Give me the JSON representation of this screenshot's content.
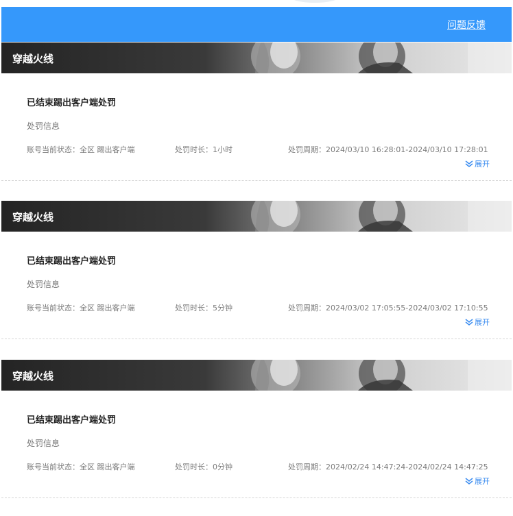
{
  "header": {
    "feedback_label": "问题反馈",
    "bg_color": "#3598fb"
  },
  "records": [
    {
      "game": "穿越火线",
      "status": "已结束踢出客户端处罚",
      "section_label": "处罚信息",
      "account_state": "账号当前状态：全区 踢出客户端",
      "duration": "处罚时长：1小时",
      "period": "处罚周期：2024/03/10 16:28:01-2024/03/10 17:28:01",
      "expand_label": "展开"
    },
    {
      "game": "穿越火线",
      "status": "已结束踢出客户端处罚",
      "section_label": "处罚信息",
      "account_state": "账号当前状态：全区 踢出客户端",
      "duration": "处罚时长：5分钟",
      "period": "处罚周期：2024/03/02 17:05:55-2024/03/02 17:10:55",
      "expand_label": "展开"
    },
    {
      "game": "穿越火线",
      "status": "已结束踢出客户端处罚",
      "section_label": "处罚信息",
      "account_state": "账号当前状态：全区 踢出客户端",
      "duration": "处罚时长：0分钟",
      "period": "处罚周期：2024/02/24 14:47:24-2024/02/24 14:47:25",
      "expand_label": "展开"
    }
  ],
  "icons": {
    "expand": "double-chevron-down-icon",
    "banner_art": "game-characters-banner-image"
  },
  "colors": {
    "accent": "#3a8cf0",
    "banner_dark": "#242424"
  }
}
